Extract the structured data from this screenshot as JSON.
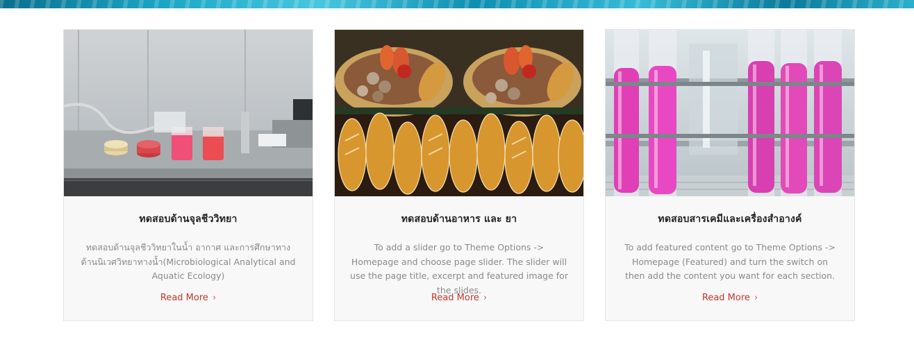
{
  "cards": [
    {
      "title": "ทดสอบด้านจุลชีววิทยา",
      "description": "ทดสอบด้านจุลชีววิทยาในน้ำ อากาศ และการศึกษาทางด้านนิเวศวิทยาทางน้ำ(Microbiological Analytical and Aquatic Ecology)",
      "read_more": "Read More",
      "image": "microbiology-lab-petri-dishes"
    },
    {
      "title": "ทดสอบด้านอาหาร และ ยา",
      "description": "To add a slider go to Theme Options -> Homepage and choose page slider. The slider will use the page title, excerpt and featured image for the slides.",
      "read_more": "Read More",
      "image": "grilled-seafood-squid"
    },
    {
      "title": "ทดสอบสารเคมีและเครื่องสำอางค์",
      "description": "To add featured content go to Theme Options -> Homepage (Featured) and turn the switch on then add the content you want for each section.",
      "read_more": "Read More",
      "image": "pink-test-tubes-rack"
    }
  ],
  "colors": {
    "accent": "#c0392b",
    "card_bg": "#f8f8f8",
    "title": "#222222",
    "text": "#8a8a8a"
  },
  "icons": {
    "read_more": "chevron-right-icon"
  }
}
